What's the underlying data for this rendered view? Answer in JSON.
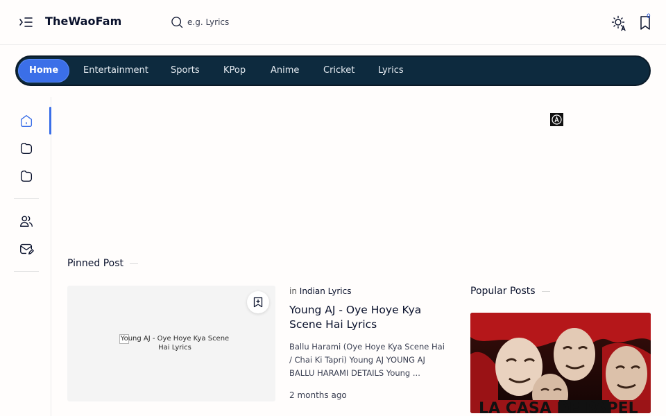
{
  "header": {
    "site_title": "TheWaoFam",
    "search_placeholder": "e.g. Lyrics",
    "bookmark_count": "0"
  },
  "nav": {
    "items": [
      {
        "label": "Home",
        "active": true
      },
      {
        "label": "Entertainment"
      },
      {
        "label": "Sports"
      },
      {
        "label": "KPop"
      },
      {
        "label": "Anime"
      },
      {
        "label": "Cricket"
      },
      {
        "label": "Lyrics"
      }
    ]
  },
  "sidebar": {
    "icons": [
      "home-icon",
      "folder-icon",
      "folder-icon",
      "users-icon",
      "mail-edit-icon"
    ]
  },
  "pinned": {
    "section_title": "Pinned Post",
    "category_prefix": "in",
    "category": "Indian Lyrics",
    "title": "Young AJ - Oye Hoye Kya Scene Hai Lyrics",
    "image_alt": "Young AJ - Oye Hoye Kya Scene Hai Lyrics",
    "snippet": "Ballu Harami (Oye Hoye Kya Scene Hai / Chai Ki Tapri) Young AJ YOUNG AJ BALLU HARAMI DETAILS Young ...",
    "date": "2 months ago"
  },
  "popular": {
    "section_title": "Popular Posts",
    "image_text": "LA CASA DE PAPEL"
  },
  "colors": {
    "accent": "#3b6fe8",
    "nav_bg": "#0d2a3e",
    "text": "#08102b"
  }
}
